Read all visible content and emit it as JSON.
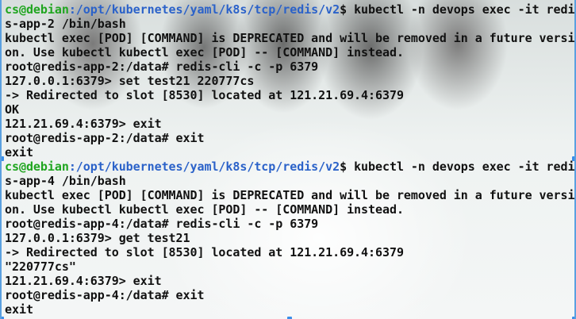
{
  "colors": {
    "prompt_user": "#1fa51f",
    "prompt_path": "#2b62c9",
    "text": "#111111",
    "selection_border": "#5aa0e0"
  },
  "terminal": {
    "lines": [
      {
        "user": "cs@debian",
        "path": ":/opt/kubernetes/yaml/k8s/tcp/redis/v2",
        "cmd": "$ kubectl -n devops exec -it redi"
      },
      {
        "text": "s-app-2 /bin/bash"
      },
      {
        "text": "kubectl exec [POD] [COMMAND] is DEPRECATED and will be removed in a future versi"
      },
      {
        "text": "on. Use kubectl kubectl exec [POD] -- [COMMAND] instead."
      },
      {
        "text": "root@redis-app-2:/data# redis-cli -c -p 6379"
      },
      {
        "text": "127.0.0.1:6379> set test21 220777cs"
      },
      {
        "text": "-> Redirected to slot [8530] located at 121.21.69.4:6379"
      },
      {
        "text": "OK"
      },
      {
        "text": "121.21.69.4:6379> exit"
      },
      {
        "text": "root@redis-app-2:/data# exit"
      },
      {
        "text": "exit"
      },
      {
        "user": "cs@debian",
        "path": ":/opt/kubernetes/yaml/k8s/tcp/redis/v2",
        "cmd": "$ kubectl -n devops exec -it redi"
      },
      {
        "text": "s-app-4 /bin/bash"
      },
      {
        "text": "kubectl exec [POD] [COMMAND] is DEPRECATED and will be removed in a future versi"
      },
      {
        "text": "on. Use kubectl kubectl exec [POD] -- [COMMAND] instead."
      },
      {
        "text": "root@redis-app-4:/data# redis-cli -c -p 6379"
      },
      {
        "text": "127.0.0.1:6379> get test21"
      },
      {
        "text": "-> Redirected to slot [8530] located at 121.21.69.4:6379"
      },
      {
        "text": "\"220777cs\""
      },
      {
        "text": "121.21.69.4:6379> exit"
      },
      {
        "text": "root@redis-app-4:/data# exit"
      },
      {
        "text": "exit"
      }
    ]
  }
}
